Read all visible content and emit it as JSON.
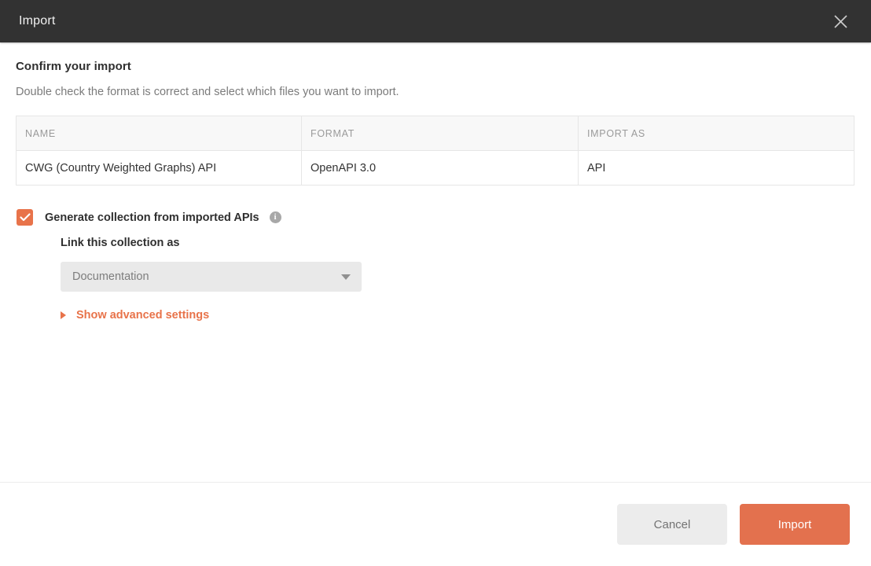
{
  "header": {
    "title": "Import",
    "close_icon": "close-icon"
  },
  "body": {
    "heading": "Confirm your import",
    "subtitle": "Double check the format is correct and select which files you want to import.",
    "table": {
      "columns": [
        "NAME",
        "FORMAT",
        "IMPORT AS"
      ],
      "rows": [
        {
          "name": "CWG (Country Weighted Graphs) API",
          "format": "OpenAPI 3.0",
          "import_as": "API"
        }
      ]
    },
    "generate_collection": {
      "checked": true,
      "label": "Generate collection from imported APIs",
      "info_icon": "i"
    },
    "link_collection": {
      "label": "Link this collection as",
      "selected": "Documentation",
      "options": [
        "Documentation"
      ]
    },
    "advanced": {
      "label": "Show advanced settings",
      "expanded": false
    }
  },
  "footer": {
    "cancel_label": "Cancel",
    "import_label": "Import"
  },
  "colors": {
    "accent": "#e3714e",
    "checkbox": "#e8734a",
    "header_bg": "#323232",
    "table_header_bg": "#f8f8f8",
    "select_bg": "#e9e9e9",
    "cancel_bg": "#ececec"
  }
}
